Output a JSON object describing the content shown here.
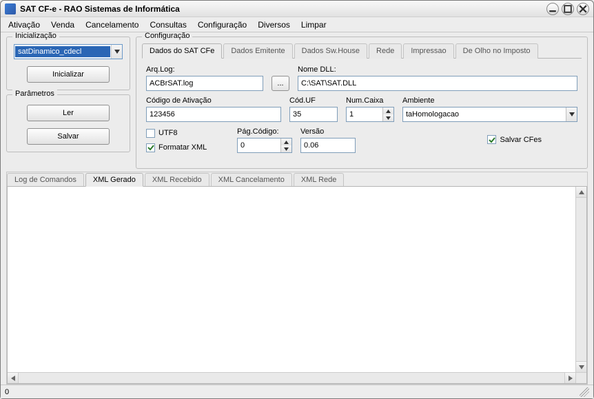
{
  "window": {
    "title": "SAT CF-e - RAO Sistemas de Informática"
  },
  "menubar": [
    "Ativação",
    "Venda",
    "Cancelamento",
    "Consultas",
    "Configuração",
    "Diversos",
    "Limpar"
  ],
  "left": {
    "init": {
      "legend": "Inicialização",
      "combo_value": "satDinamico_cdecl",
      "init_button": "Inicializar"
    },
    "params": {
      "legend": "Parâmetros",
      "read_button": "Ler",
      "save_button": "Salvar"
    }
  },
  "config": {
    "legend": "Configuração",
    "tabs": [
      "Dados do SAT CFe",
      "Dados Emitente",
      "Dados Sw.House",
      "Rede",
      "Impressao",
      "De Olho no Imposto"
    ],
    "fields": {
      "arqlog_label": "Arq.Log:",
      "arqlog_value": "ACBrSAT.log",
      "browse": "...",
      "nomedll_label": "Nome DLL:",
      "nomedll_value": "C:\\SAT\\SAT.DLL",
      "codativ_label": "Código de Ativação",
      "codativ_value": "123456",
      "coduf_label": "Cód.UF",
      "coduf_value": "35",
      "numcaixa_label": "Num.Caixa",
      "numcaixa_value": "1",
      "ambiente_label": "Ambiente",
      "ambiente_value": "taHomologacao",
      "utf8_label": "UTF8",
      "utf8_checked": false,
      "formatarxml_label": "Formatar XML",
      "formatarxml_checked": true,
      "pagcodigo_label": "Pág.Código:",
      "pagcodigo_value": "0",
      "versao_label": "Versão",
      "versao_value": "0.06",
      "salvarcfes_label": "Salvar CFes",
      "salvarcfes_checked": true
    }
  },
  "lower_tabs": [
    "Log de Comandos",
    "XML Gerado",
    "XML Recebido",
    "XML Cancelamento",
    "XML Rede"
  ],
  "lower_active": 1,
  "status": {
    "left": "0"
  }
}
